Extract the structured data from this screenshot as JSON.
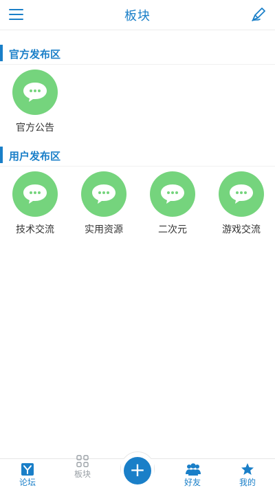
{
  "header": {
    "title": "板块",
    "menu_icon": "hamburger-menu-icon",
    "edit_icon": "pen-edit-icon"
  },
  "sections": {
    "official": {
      "title": "官方发布区",
      "boards": [
        {
          "label": "官方公告",
          "icon": "chat-bubble-icon"
        }
      ]
    },
    "user": {
      "title": "用户发布区",
      "boards": [
        {
          "label": "技术交流",
          "icon": "chat-bubble-icon"
        },
        {
          "label": "实用资源",
          "icon": "chat-bubble-icon"
        },
        {
          "label": "二次元",
          "icon": "chat-bubble-icon"
        },
        {
          "label": "游戏交流",
          "icon": "chat-bubble-icon"
        }
      ]
    }
  },
  "bottom_nav": {
    "items": [
      {
        "label": "论坛",
        "icon": "forum-y-icon",
        "active": false
      },
      {
        "label": "板块",
        "icon": "grid-icon",
        "active": true
      },
      {
        "label": "好友",
        "icon": "friends-icon",
        "active": false
      },
      {
        "label": "我的",
        "icon": "star-icon",
        "active": false
      }
    ],
    "add_label": "+"
  },
  "colors": {
    "primary": "#1a7fc8",
    "board_icon_bg": "#75d47d",
    "inactive_nav": "#9aa0a6"
  }
}
